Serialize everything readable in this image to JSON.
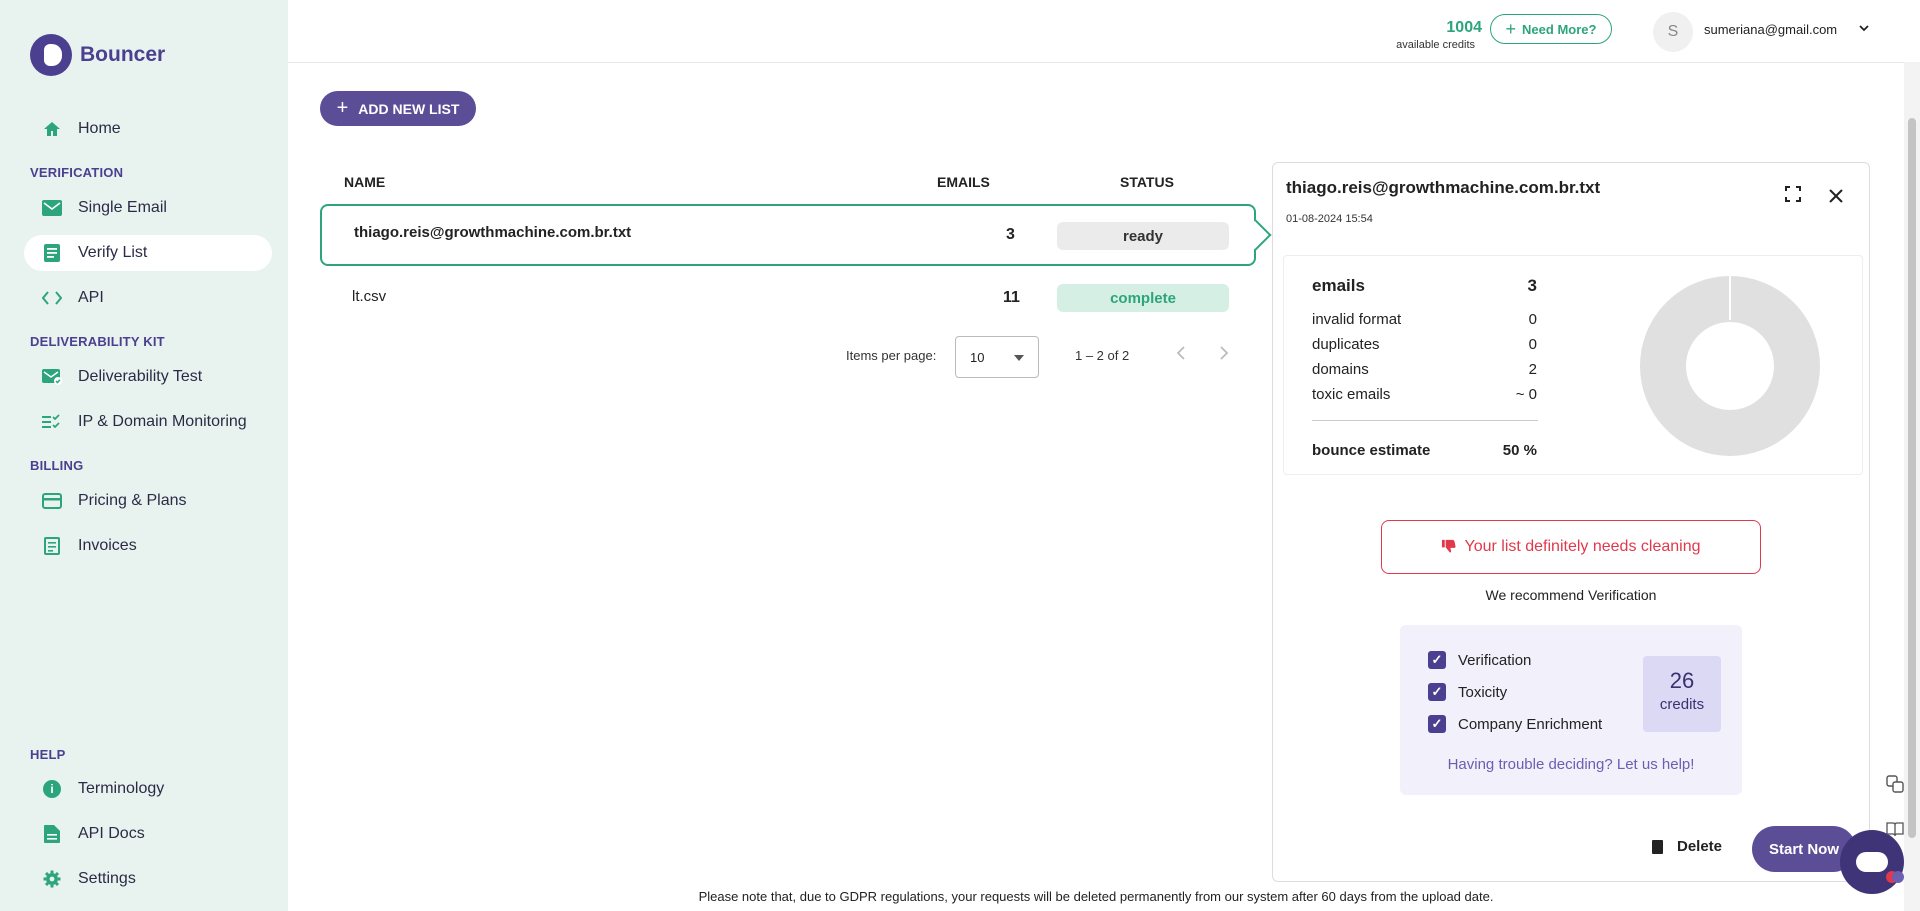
{
  "app": {
    "name": "Bouncer"
  },
  "sidebar": {
    "home": "Home",
    "sections": {
      "verification": "VERIFICATION",
      "deliverability": "DELIVERABILITY KIT",
      "billing": "BILLING",
      "help": "HELP"
    },
    "items": {
      "single_email": "Single Email",
      "verify_list": "Verify List",
      "api": "API",
      "deliverability_test": "Deliverability Test",
      "ip_domain": "IP & Domain Monitoring",
      "pricing": "Pricing & Plans",
      "invoices": "Invoices",
      "terminology": "Terminology",
      "api_docs": "API Docs",
      "settings": "Settings"
    },
    "active_item": "Verify List",
    "accent_color": "#2da57c"
  },
  "header": {
    "credits_value": "1004",
    "credits_label": "available credits",
    "need_more": "Need More?",
    "avatar_initial": "S",
    "user_email": "sumeriana@gmail.com"
  },
  "main": {
    "add_button": "ADD NEW LIST",
    "columns": {
      "name": "NAME",
      "emails": "EMAILS",
      "status": "STATUS"
    },
    "rows": [
      {
        "name": "thiago.reis@growthmachine.com.br.txt",
        "emails": "3",
        "status": "ready"
      },
      {
        "name": "lt.csv",
        "emails": "11",
        "status": "complete"
      }
    ],
    "pagination": {
      "items_per_page_label": "Items per page:",
      "items_per_page_value": "10",
      "range": "1 – 2 of 2"
    },
    "footer_note": "Please note that, due to GDPR regulations, your requests will be deleted permanently from our system after 60 days from the upload date."
  },
  "panel": {
    "title": "thiago.reis@growthmachine.com.br.txt",
    "date": "01-08-2024 15:54",
    "stats": {
      "emails_label": "emails",
      "emails_value": "3",
      "invalid_label": "invalid format",
      "invalid_value": "0",
      "duplicates_label": "duplicates",
      "duplicates_value": "0",
      "domains_label": "domains",
      "domains_value": "2",
      "toxic_label": "toxic emails",
      "toxic_value": "~ 0",
      "bounce_label": "bounce estimate",
      "bounce_value": "50 %"
    },
    "warning": "Your list definitely needs cleaning",
    "recommendation": "We recommend Verification",
    "options": [
      "Verification",
      "Toxicity",
      "Company Enrichment"
    ],
    "credits_value": "26",
    "credits_label": "credits",
    "help_link": "Having trouble deciding? Let us help!",
    "delete": "Delete",
    "start": "Start Now",
    "warning_color": "#e0394c",
    "brand_color": "#5b4e97"
  }
}
